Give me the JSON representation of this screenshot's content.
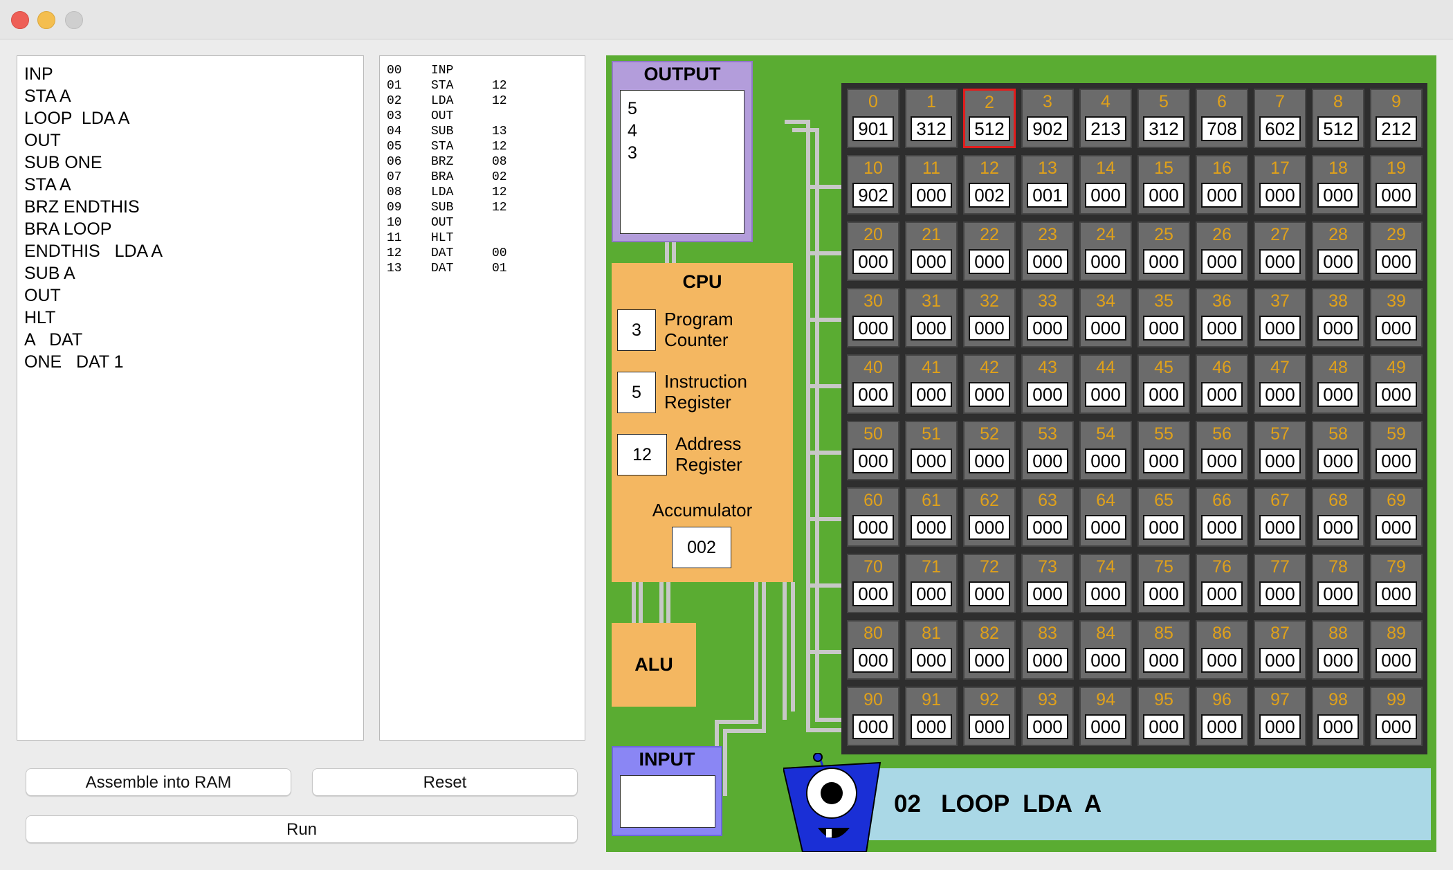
{
  "window": {
    "controls": [
      "close",
      "minimize",
      "maximize"
    ]
  },
  "editor": {
    "lines": [
      "INP",
      "STA A",
      "LOOP  LDA A",
      "OUT",
      "SUB ONE",
      "STA A",
      "BRZ ENDTHIS",
      "BRA LOOP",
      "ENDTHIS   LDA A",
      "SUB A",
      "OUT",
      "HLT",
      "A   DAT",
      "ONE   DAT 1"
    ]
  },
  "listing": [
    [
      "00",
      "INP",
      ""
    ],
    [
      "01",
      "STA",
      "12"
    ],
    [
      "02",
      "LDA",
      "12"
    ],
    [
      "03",
      "OUT",
      ""
    ],
    [
      "04",
      "SUB",
      "13"
    ],
    [
      "05",
      "STA",
      "12"
    ],
    [
      "06",
      "BRZ",
      "08"
    ],
    [
      "07",
      "BRA",
      "02"
    ],
    [
      "08",
      "LDA",
      "12"
    ],
    [
      "09",
      "SUB",
      "12"
    ],
    [
      "10",
      "OUT",
      ""
    ],
    [
      "11",
      "HLT",
      ""
    ],
    [
      "12",
      "DAT",
      "00"
    ],
    [
      "13",
      "DAT",
      "01"
    ]
  ],
  "buttons": {
    "assemble": "Assemble into RAM",
    "reset": "Reset",
    "run": "Run"
  },
  "output": {
    "title": "OUTPUT",
    "lines": [
      "5",
      "4",
      "3"
    ]
  },
  "cpu": {
    "title": "CPU",
    "program_counter": {
      "value": "3",
      "label_line1": "Program",
      "label_line2": "Counter"
    },
    "instruction_register": {
      "value": "5",
      "label_line1": "Instruction",
      "label_line2": "Register"
    },
    "address_register": {
      "value": "12",
      "label_line1": "Address",
      "label_line2": "Register"
    },
    "accumulator": {
      "label": "Accumulator",
      "value": "002"
    }
  },
  "alu": {
    "label": "ALU"
  },
  "input": {
    "title": "INPUT",
    "value": ""
  },
  "ram": {
    "active_address": 2,
    "values": [
      "901",
      "312",
      "512",
      "902",
      "213",
      "312",
      "708",
      "602",
      "512",
      "212",
      "902",
      "000",
      "002",
      "001",
      "000",
      "000",
      "000",
      "000",
      "000",
      "000",
      "000",
      "000",
      "000",
      "000",
      "000",
      "000",
      "000",
      "000",
      "000",
      "000",
      "000",
      "000",
      "000",
      "000",
      "000",
      "000",
      "000",
      "000",
      "000",
      "000",
      "000",
      "000",
      "000",
      "000",
      "000",
      "000",
      "000",
      "000",
      "000",
      "000",
      "000",
      "000",
      "000",
      "000",
      "000",
      "000",
      "000",
      "000",
      "000",
      "000",
      "000",
      "000",
      "000",
      "000",
      "000",
      "000",
      "000",
      "000",
      "000",
      "000",
      "000",
      "000",
      "000",
      "000",
      "000",
      "000",
      "000",
      "000",
      "000",
      "000",
      "000",
      "000",
      "000",
      "000",
      "000",
      "000",
      "000",
      "000",
      "000",
      "000",
      "000",
      "000",
      "000",
      "000",
      "000",
      "000",
      "000",
      "000",
      "000",
      "000"
    ]
  },
  "status": {
    "line": "02   LOOP  LDA  A"
  },
  "colors": {
    "board": "#5aac32",
    "cpu": "#f4b761",
    "output": "#b39ddb",
    "input": "#8a86f4",
    "ram_cell": "#6b6b6b",
    "address_text": "#e0a11a",
    "active_cell_border": "#e21d1d",
    "status_bar": "#aad8e6"
  }
}
